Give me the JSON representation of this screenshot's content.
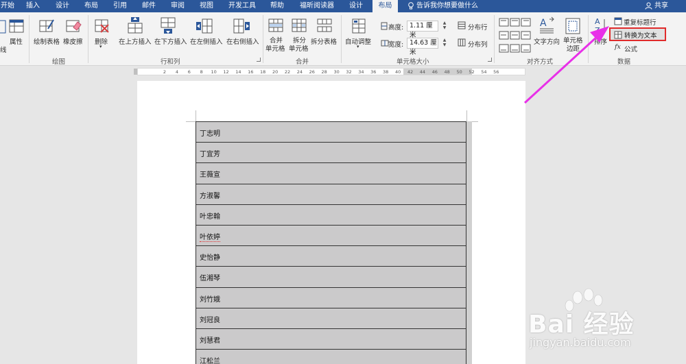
{
  "tabs": [
    {
      "label": "开始",
      "active": false
    },
    {
      "label": "插入",
      "active": false
    },
    {
      "label": "设计",
      "active": false
    },
    {
      "label": "布局",
      "active": false
    },
    {
      "label": "引用",
      "active": false
    },
    {
      "label": "邮件",
      "active": false
    },
    {
      "label": "审阅",
      "active": false
    },
    {
      "label": "视图",
      "active": false
    },
    {
      "label": "开发工具",
      "active": false
    },
    {
      "label": "帮助",
      "active": false
    },
    {
      "label": "福昕阅读器",
      "active": false
    },
    {
      "label": "设计",
      "active": false
    },
    {
      "label": "布局",
      "active": true
    }
  ],
  "tell_me": "告诉我你想要做什么",
  "share": "共享",
  "ribbon": {
    "partial_left": "线",
    "properties": "属性",
    "draw": {
      "draw_table": "绘制表格",
      "eraser": "橡皮擦",
      "group": "绘图"
    },
    "rows_cols": {
      "delete": "删除",
      "insert_above": "在上方插入",
      "insert_below": "在下方插入",
      "insert_left": "在左侧插入",
      "insert_right": "在右侧插入",
      "group": "行和列"
    },
    "merge": {
      "merge_cells_1": "合并",
      "merge_cells_2": "单元格",
      "split_cells_1": "拆分",
      "split_cells_2": "单元格",
      "split_table": "拆分表格",
      "group": "合并"
    },
    "cell_size": {
      "autofit": "自动调整",
      "height_label": "高度:",
      "height_value": "1.11 厘米",
      "width_label": "宽度:",
      "width_value": "14.63 厘米",
      "distribute_rows": "分布行",
      "distribute_cols": "分布列",
      "group": "单元格大小"
    },
    "alignment": {
      "text_direction": "文字方向",
      "cell_margins_1": "单元格",
      "cell_margins_2": "边距",
      "group": "对齐方式"
    },
    "data": {
      "sort": "排序",
      "repeat_header": "重复标题行",
      "convert_to_text": "转换为文本",
      "formula": "公式",
      "group": "数据"
    }
  },
  "ruler_ticks": [
    "2",
    "4",
    "6",
    "8",
    "10",
    "12",
    "14",
    "16",
    "18",
    "20",
    "22",
    "24",
    "26",
    "28",
    "30",
    "32",
    "34",
    "36",
    "38",
    "40",
    "42",
    "44",
    "46",
    "48",
    "50",
    "52",
    "54",
    "56"
  ],
  "table_rows": [
    "丁志明",
    "丁宜芳",
    "王薇宣",
    "方淑馨",
    "叶忠翰",
    "叶依婷",
    "史怡静",
    "伍湘琴",
    "刘竹娥",
    "刘冠良",
    "刘慧君",
    "江松兰"
  ],
  "watermark": {
    "brand": "Bai 经验",
    "url": "jingyan.baidu.com"
  },
  "colors": {
    "tabbar": "#2b579a",
    "ribbon": "#f3f3f3",
    "highlight_box": "#e02a2a",
    "arrow": "#e830e8",
    "table_fill": "#cbcacb"
  }
}
